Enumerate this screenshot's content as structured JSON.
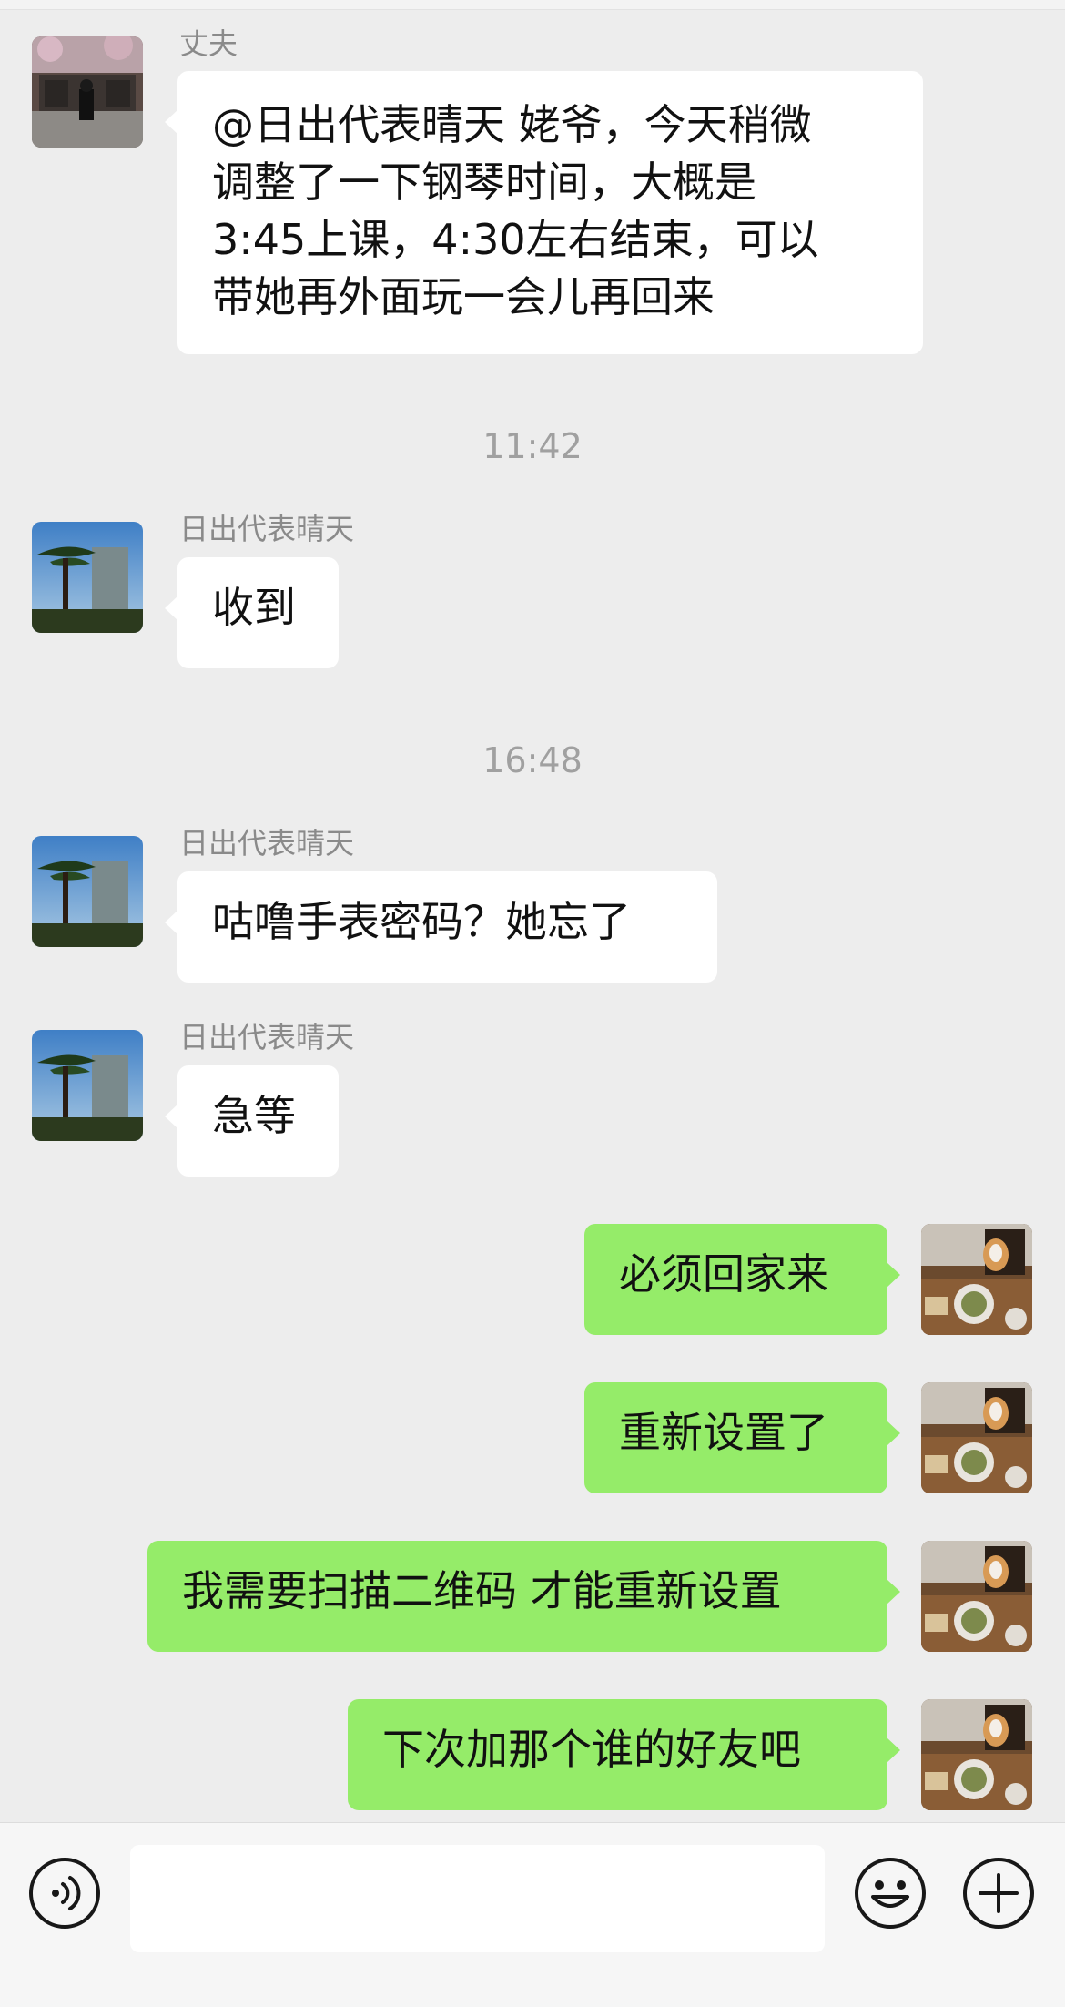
{
  "messages": {
    "m1": {
      "sender": "丈夫",
      "text": "@日出代表晴天 姥爷，今天稍微\n调整了一下钢琴时间，大概是\n3:45上课，4:30左右结束，可以\n带她再外面玩一会儿再回来"
    },
    "t1": "11:42",
    "m2": {
      "sender": "日出代表晴天",
      "text": "收到"
    },
    "t2": "16:48",
    "m3": {
      "sender": "日出代表晴天",
      "text": "咕噜手表密码？她忘了"
    },
    "m4": {
      "sender": "日出代表晴天",
      "text": "急等"
    },
    "m5": {
      "text": "必须回家来"
    },
    "m6": {
      "text": "重新设置了"
    },
    "m7": {
      "text": "我需要扫描二维码 才能重新设置"
    },
    "m8": {
      "text": "下次加那个谁的好友吧"
    }
  },
  "input": {
    "value": "",
    "placeholder": ""
  },
  "colors": {
    "background": "#ededed",
    "incoming_bubble": "#ffffff",
    "outgoing_bubble": "#95ec69"
  },
  "icons": [
    "voice-icon",
    "emoji-icon",
    "plus-icon"
  ]
}
